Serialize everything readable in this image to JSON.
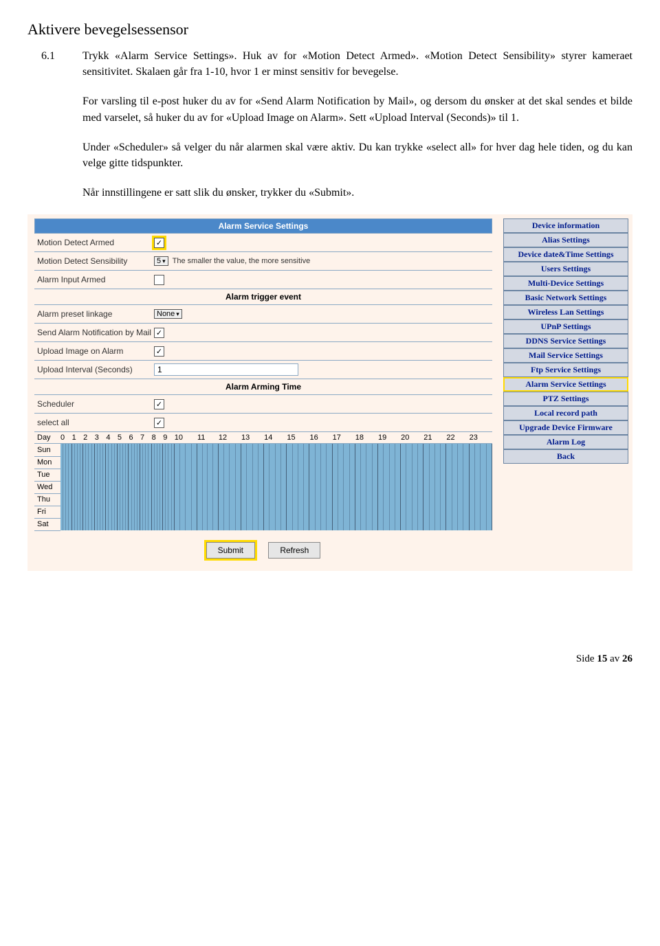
{
  "doc": {
    "title": "Aktivere bevegelsessensor",
    "section_number": "6.1",
    "para1": "Trykk «Alarm Service Settings». Huk av for «Motion Detect Armed». «Motion Detect Sensibility» styrer kameraet sensitivitet. Skalaen går fra 1-10, hvor 1 er minst sensitiv for bevegelse.",
    "para2": "For varsling til e-post huker du av for «Send Alarm Notification by Mail», og dersom du ønsker at det skal sendes et bilde med varselet, så huker du av for «Upload Image on Alarm». Sett «Upload Interval (Seconds)» til 1.",
    "para3": "Under «Scheduler» så velger du når alarmen skal være aktiv. Du kan trykke «select all» for hver dag hele tiden, og du kan velge gitte tidspunkter.",
    "para4": "Når innstillingene er satt slik du ønsker, trykker du «Submit»."
  },
  "panel": {
    "header": "Alarm Service Settings",
    "fields": {
      "motion_detect_armed": {
        "label": "Motion Detect Armed",
        "checked": true
      },
      "motion_detect_sensibility": {
        "label": "Motion Detect Sensibility",
        "value": "5",
        "hint": "The smaller the value, the more sensitive"
      },
      "alarm_input_armed": {
        "label": "Alarm Input Armed",
        "checked": false
      },
      "trigger_header": "Alarm trigger event",
      "alarm_preset_linkage": {
        "label": "Alarm preset linkage",
        "value": "None"
      },
      "send_alarm_mail": {
        "label": "Send Alarm Notification by Mail",
        "checked": true
      },
      "upload_image": {
        "label": "Upload Image on Alarm",
        "checked": true
      },
      "upload_interval": {
        "label": "Upload Interval (Seconds)",
        "value": "1"
      },
      "arming_header": "Alarm Arming Time",
      "scheduler": {
        "label": "Scheduler",
        "checked": true
      },
      "select_all": {
        "label": "select all",
        "checked": true
      }
    },
    "schedule": {
      "day_header": "Day",
      "hours": [
        "0",
        "1",
        "2",
        "3",
        "4",
        "5",
        "6",
        "7",
        "8",
        "9",
        "10",
        "11",
        "12",
        "13",
        "14",
        "15",
        "16",
        "17",
        "18",
        "19",
        "20",
        "21",
        "22",
        "23"
      ],
      "days": [
        "Sun",
        "Mon",
        "Tue",
        "Wed",
        "Thu",
        "Fri",
        "Sat"
      ]
    },
    "buttons": {
      "submit": "Submit",
      "refresh": "Refresh"
    }
  },
  "menu": [
    "Device information",
    "Alias Settings",
    "Device date&Time Settings",
    "Users Settings",
    "Multi-Device Settings",
    "Basic Network Settings",
    "Wireless Lan Settings",
    "UPnP Settings",
    "DDNS Service Settings",
    "Mail Service Settings",
    "Ftp Service Settings",
    "Alarm Service Settings",
    "PTZ Settings",
    "Local record path",
    "Upgrade Device Firmware",
    "Alarm Log",
    "Back"
  ],
  "menu_highlight_index": 11,
  "footer": {
    "prefix": "Side ",
    "current": "15",
    "sep": " av ",
    "total": "26"
  }
}
